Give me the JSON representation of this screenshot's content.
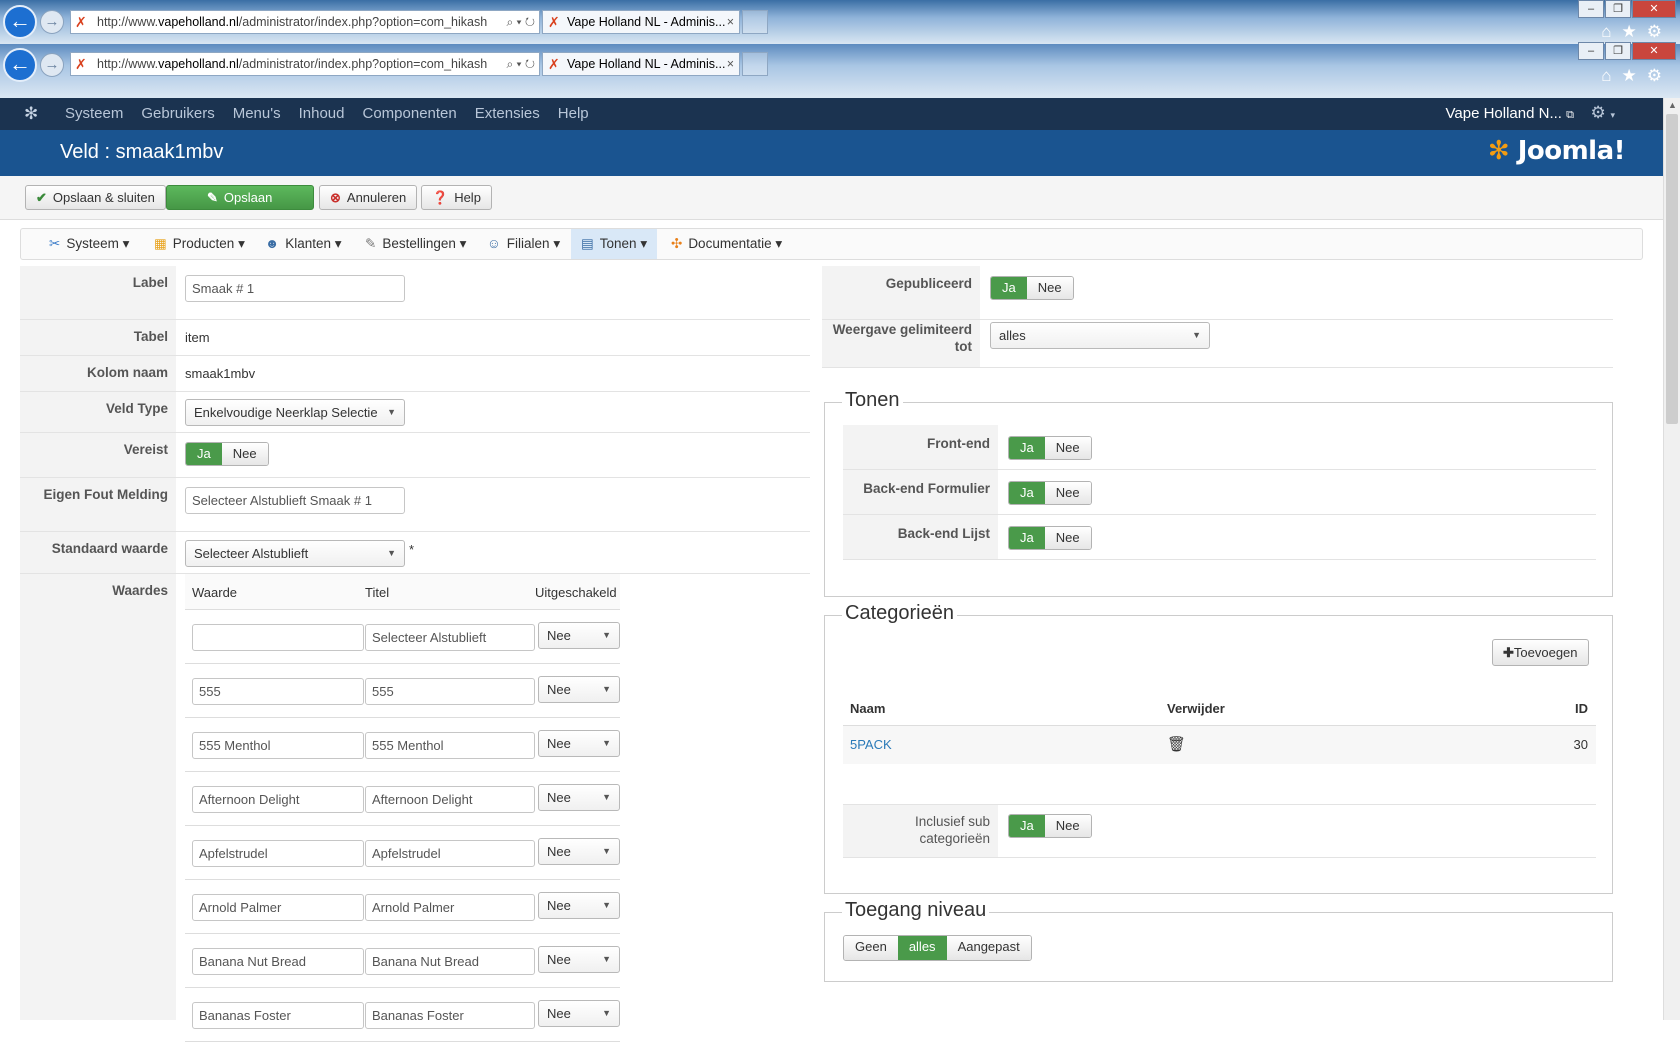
{
  "browser": {
    "url_prefix": "http://www.",
    "url_domain": "vapeholland.nl",
    "url_suffix": "/administrator/index.php?option=com_hikash",
    "tab_title": "Vape Holland NL - Adminis...",
    "tab_close": "×",
    "back_arrow": "←",
    "forward_arrow": "→"
  },
  "topnav": {
    "items": [
      "Systeem",
      "Gebruikers",
      "Menu's",
      "Inhoud",
      "Componenten",
      "Extensies",
      "Help"
    ],
    "site_name": "Vape Holland N...",
    "icons": [
      "joomla-icon",
      "external-link-icon",
      "gear-icon"
    ]
  },
  "header": {
    "title": "Veld : smaak1mbv",
    "brand": "Joomla!"
  },
  "toolbar": {
    "save_close": "Opslaan & sluiten",
    "save": "Opslaan",
    "cancel": "Annuleren",
    "help": "Help"
  },
  "tabs": [
    "Systeem",
    "Producten",
    "Klanten",
    "Bestellingen",
    "Filialen",
    "Tonen",
    "Documentatie"
  ],
  "active_tab": "Tonen",
  "form": {
    "label_label": "Label",
    "label_value": "Smaak # 1",
    "table_label": "Tabel",
    "table_value": "item",
    "column_label": "Kolom naam",
    "column_value": "smaak1mbv",
    "fieldtype_label": "Veld Type",
    "fieldtype_value": "Enkelvoudige Neerklap Selectie",
    "required_label": "Vereist",
    "error_label": "Eigen Fout Melding",
    "error_value": "Selecteer Alstublieft Smaak # 1",
    "default_label": "Standaard waarde",
    "default_value": "Selecteer Alstublieft",
    "default_asterisk": "*",
    "values_label": "Waardes",
    "yes": "Ja",
    "no": "Nee"
  },
  "values_table": {
    "headers": [
      "Waarde",
      "Titel",
      "Uitgeschakeld"
    ],
    "rows": [
      {
        "value": "",
        "title": "Selecteer Alstublieft",
        "disabled": "Nee"
      },
      {
        "value": "555",
        "title": "555",
        "disabled": "Nee"
      },
      {
        "value": "555 Menthol",
        "title": "555 Menthol",
        "disabled": "Nee"
      },
      {
        "value": "Afternoon Delight",
        "title": "Afternoon Delight",
        "disabled": "Nee"
      },
      {
        "value": "Apfelstrudel",
        "title": "Apfelstrudel",
        "disabled": "Nee"
      },
      {
        "value": "Arnold Palmer",
        "title": "Arnold Palmer",
        "disabled": "Nee"
      },
      {
        "value": "Banana Nut Bread",
        "title": "Banana Nut Bread",
        "disabled": "Nee"
      },
      {
        "value": "Bananas Foster",
        "title": "Bananas Foster",
        "disabled": "Nee"
      }
    ]
  },
  "right": {
    "published_label": "Gepubliceerd",
    "limited_label": "Weergave gelimiteerd tot",
    "limited_value": "alles",
    "tonen_legend": "Tonen",
    "frontend_label": "Front-end",
    "backend_form_label": "Back-end Formulier",
    "backend_list_label": "Back-end Lijst",
    "categories_legend": "Categorieën",
    "add_button": "Toevoegen",
    "cat_headers": [
      "Naam",
      "Verwijder",
      "ID"
    ],
    "categories": [
      {
        "name": "5PACK",
        "id": "30"
      }
    ],
    "include_sub_label": "Inclusief sub categorieën",
    "access_legend": "Toegang niveau",
    "access_options": [
      "Geen",
      "alles",
      "Aangepast"
    ],
    "access_selected": "alles"
  },
  "colors": {
    "nav_bg": "#1b3350",
    "header_bg": "#1a5490",
    "toggle_on": "#4a9a4a",
    "link": "#2a7ab8"
  }
}
